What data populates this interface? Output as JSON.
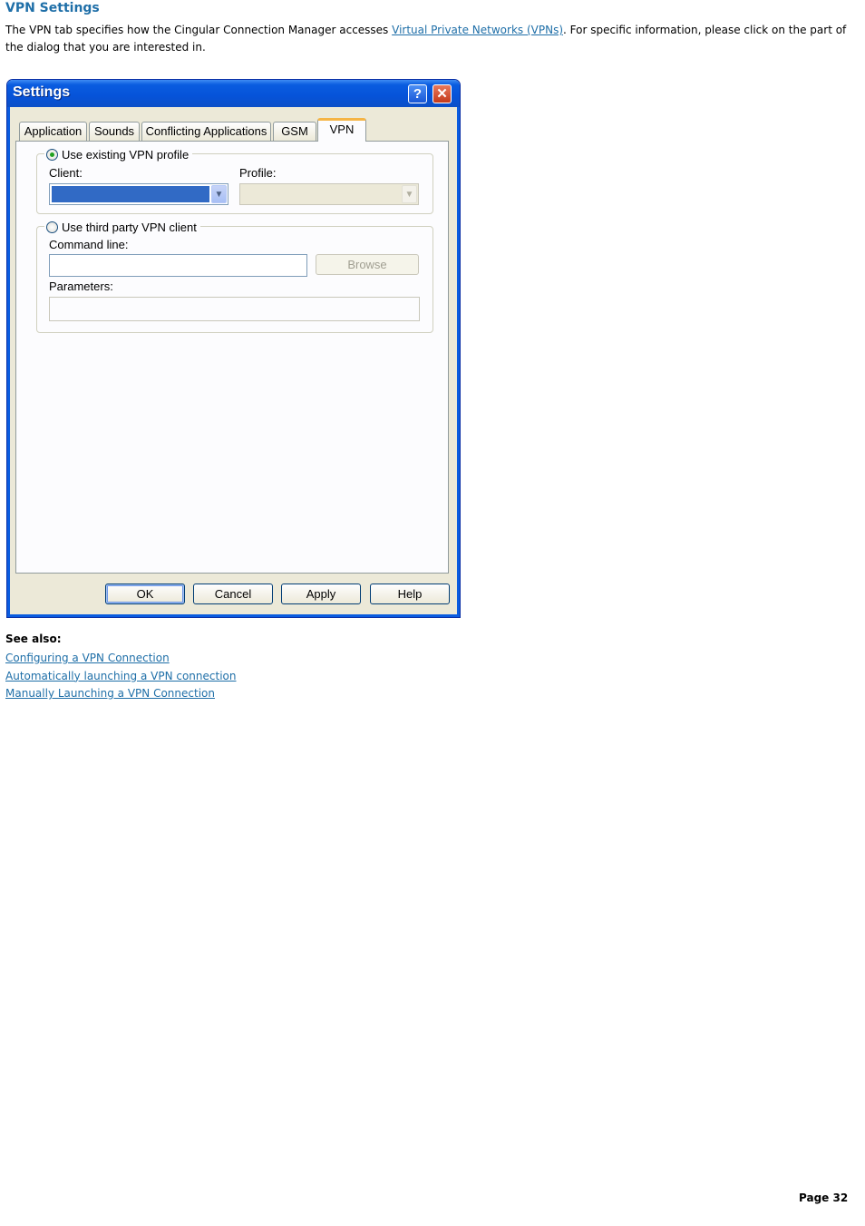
{
  "heading": "VPN Settings",
  "intro": {
    "before_link": "The VPN tab specifies how the Cingular Connection Manager accesses ",
    "link_text": "Virtual Private Networks (VPNs)",
    "after_link": ". For specific information, please click on the part of the dialog that you are interested in."
  },
  "dialog": {
    "title": "Settings",
    "help_glyph": "?",
    "close_glyph": "✕",
    "tabs": [
      "Application",
      "Sounds",
      "Conflicting Applications",
      "GSM",
      "VPN"
    ],
    "active_tab": "VPN",
    "existing_vpn": {
      "radio_label": "Use existing VPN profile",
      "checked": true,
      "client_label": "Client:",
      "profile_label": "Profile:"
    },
    "third_party": {
      "radio_label": "Use third party VPN client",
      "checked": false,
      "command_line_label": "Command line:",
      "browse_label": "Browse",
      "parameters_label": "Parameters:"
    },
    "buttons": {
      "ok": "OK",
      "cancel": "Cancel",
      "apply": "Apply",
      "help": "Help"
    }
  },
  "see_also": {
    "label": "See also:",
    "links": [
      "Configuring a VPN Connection",
      "Automatically launching a VPN connection",
      "Manually Launching a VPN Connection"
    ]
  },
  "page_number": "Page 32",
  "colors": {
    "heading": "#1f6fa8",
    "titlebar": "#0653d9",
    "dialog_face": "#ece9d8",
    "selection": "#316ac5"
  }
}
